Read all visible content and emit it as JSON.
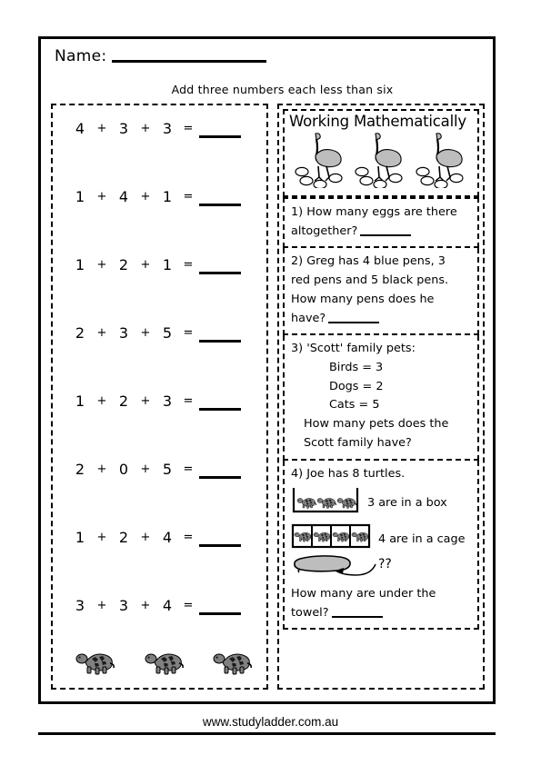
{
  "header": {
    "name_label": "Name:",
    "subtitle": "Add three numbers each less than six"
  },
  "left_panel": {
    "problems": [
      {
        "a": "4",
        "op1": "+",
        "b": "3",
        "op2": "+",
        "c": "3",
        "eq": "="
      },
      {
        "a": "1",
        "op1": "+",
        "b": "4",
        "op2": "+",
        "c": "1",
        "eq": "="
      },
      {
        "a": "1",
        "op1": "+",
        "b": "2",
        "op2": "+",
        "c": "1",
        "eq": "="
      },
      {
        "a": "2",
        "op1": "+",
        "b": "3",
        "op2": "+",
        "c": "5",
        "eq": "="
      },
      {
        "a": "1",
        "op1": "+",
        "b": "2",
        "op2": "+",
        "c": "3",
        "eq": "="
      },
      {
        "a": "2",
        "op1": "+",
        "b": "0",
        "op2": "+",
        "c": "5",
        "eq": "="
      },
      {
        "a": "1",
        "op1": "+",
        "b": "2",
        "op2": "+",
        "c": "4",
        "eq": "="
      },
      {
        "a": "3",
        "op1": "+",
        "b": "3",
        "op2": "+",
        "c": "4",
        "eq": "="
      }
    ],
    "turtle_count": 3
  },
  "right_panel": {
    "title": "Working Mathematically",
    "emu_count": 3,
    "q1": {
      "line1": "1)  How many eggs are there",
      "line2": "altogether?"
    },
    "q2": {
      "line1": "2)  Greg has 4 blue pens, 3",
      "line2": "red pens and 5 black pens.",
      "line3": "How many pens does he",
      "line4": "have?"
    },
    "q3": {
      "line1": "3)   'Scott' family pets:",
      "birds": "Birds = 3",
      "dogs": "Dogs = 2",
      "cats": "Cats = 5",
      "line2": "How many pets does the",
      "line3": "Scott family have?"
    },
    "q4": {
      "line1": "4)   Joe has 8 turtles.",
      "box_text": "3 are in a box",
      "box_turtles": 3,
      "cage_text": "4 are in a cage",
      "cage_turtles": 4,
      "unknown_marker": "??",
      "line2": "How many are under the",
      "line3": "towel?"
    }
  },
  "footer": {
    "url": "www.studyladder.com.au"
  },
  "colors": {
    "ink": "#000000",
    "paper": "#ffffff",
    "animal_fill": "#bdbdbd",
    "turtle_fill": "#808080"
  }
}
